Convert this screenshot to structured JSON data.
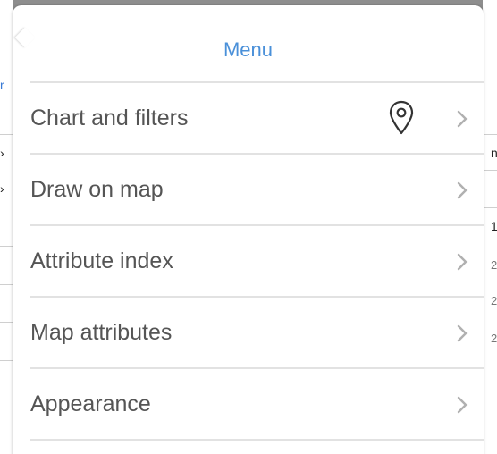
{
  "menu": {
    "title": "Menu",
    "items": [
      {
        "label": "Chart and filters",
        "icon": "map-pin-icon",
        "chevron": "chevron-right-icon"
      },
      {
        "label": "Draw on map",
        "chevron": "chevron-right-icon"
      },
      {
        "label": "Attribute index",
        "chevron": "chevron-right-icon"
      },
      {
        "label": "Map attributes",
        "chevron": "chevron-right-icon"
      },
      {
        "label": "Appearance",
        "chevron": "chevron-right-icon"
      }
    ]
  },
  "colors": {
    "title": "#4a90d9",
    "label": "#555555",
    "divider": "#e2e2e2",
    "chevron": "#b0b0b0",
    "overlay": "#8e8e8e"
  }
}
